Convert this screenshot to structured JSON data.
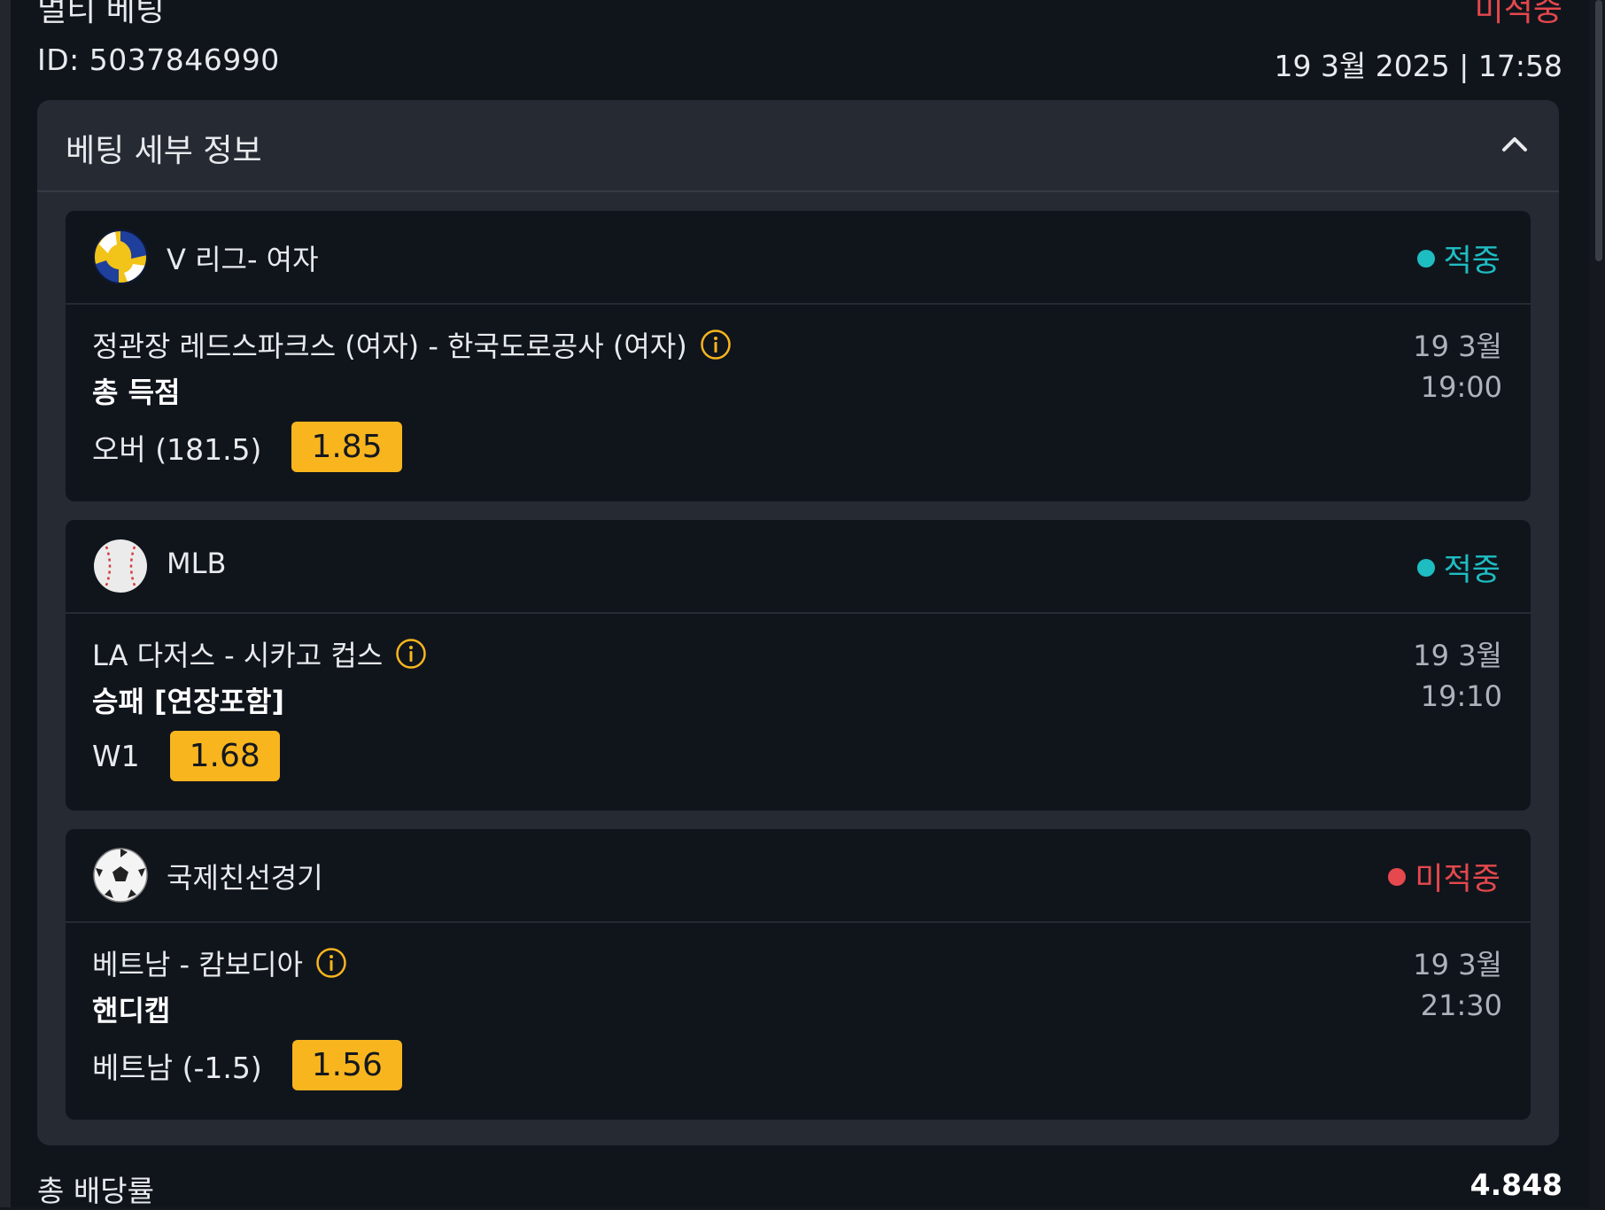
{
  "header": {
    "title": "멀티 베팅",
    "status": "미적중",
    "id_text": "ID: 5037846990",
    "datetime": "19 3월 2025 | 17:58"
  },
  "panel": {
    "title": "베팅 세부 정보",
    "collapse_icon": "chevron-up-icon"
  },
  "bets": [
    {
      "sport_icon": "volleyball-icon",
      "league": "V 리그- 여자",
      "result": "적중",
      "result_color": "#1ebdc2",
      "match": "정관장 레드스파크스 (여자) - 한국도로공사 (여자)",
      "market": "총 득점",
      "selection": "오버 (181.5)",
      "odds": "1.85",
      "date": "19 3월",
      "time": "19:00"
    },
    {
      "sport_icon": "baseball-icon",
      "league": "MLB",
      "result": "적중",
      "result_color": "#1ebdc2",
      "match": "LA 다저스 - 시카고 컵스",
      "market": "승패 [연장포함]",
      "selection": "W1",
      "odds": "1.68",
      "date": "19 3월",
      "time": "19:10"
    },
    {
      "sport_icon": "soccer-ball-icon",
      "league": "국제친선경기",
      "result": "미적중",
      "result_color": "#e5484d",
      "match": "베트남 - 캄보디아",
      "market": "핸디캡",
      "selection": "베트남 (-1.5)",
      "odds": "1.56",
      "date": "19 3월",
      "time": "21:30"
    }
  ],
  "total": {
    "label": "총 배당률",
    "value": "4.848"
  },
  "colors": {
    "accent_odds": "#f8b51e",
    "win": "#1ebdc2",
    "loss": "#e5484d",
    "background": "#10151c",
    "panel": "#262a33"
  }
}
